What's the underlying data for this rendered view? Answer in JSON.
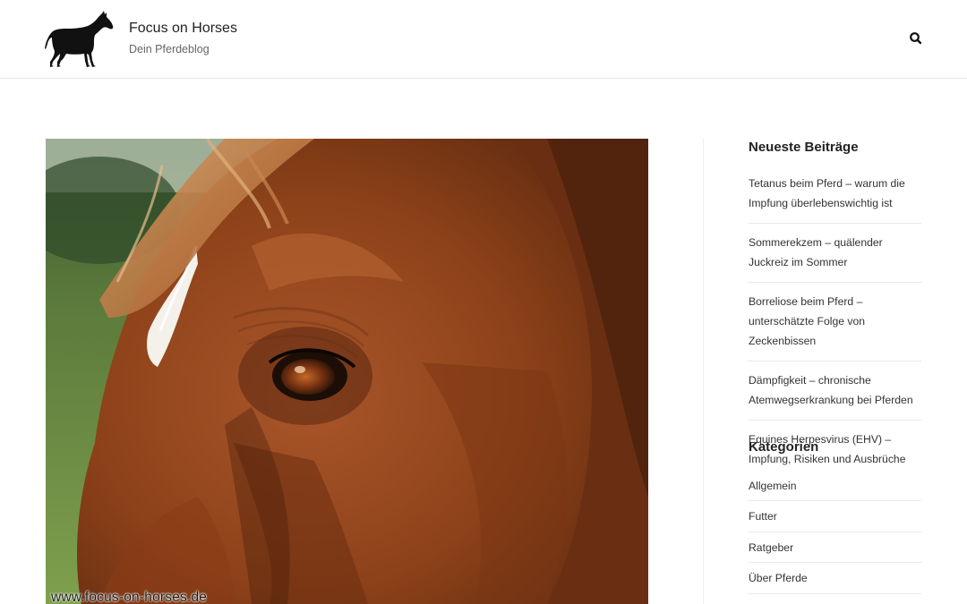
{
  "header": {
    "site_title": "Focus on Horses",
    "tagline": "Dein Pferdeblog",
    "logo_icon": "horse-silhouette-icon",
    "search_icon": "search-icon"
  },
  "featured_image": {
    "watermark": "www.focus-on-horses.de"
  },
  "sidebar": {
    "recent_posts": {
      "title": "Neueste Beiträge",
      "items": [
        {
          "label": "Tetanus beim Pferd – warum die Impfung überlebenswichtig ist"
        },
        {
          "label": "Sommerekzem – quälender Juckreiz im Sommer"
        },
        {
          "label": "Borreliose beim Pferd – unterschätzte Folge von Zeckenbissen"
        },
        {
          "label": "Dämpfigkeit – chronische Atemwegserkrankung bei Pferden"
        },
        {
          "label": "Equines Herpesvirus (EHV) – Impfung, Risiken und Ausbrüche"
        }
      ]
    },
    "categories": {
      "title": "Kategorien",
      "items": [
        {
          "label": "Allgemein"
        },
        {
          "label": "Futter"
        },
        {
          "label": "Ratgeber"
        },
        {
          "label": "Über Pferde"
        }
      ]
    }
  },
  "colors": {
    "horse_coat": "#9b4a20",
    "text": "#333333",
    "divider": "#e8e8e8"
  }
}
